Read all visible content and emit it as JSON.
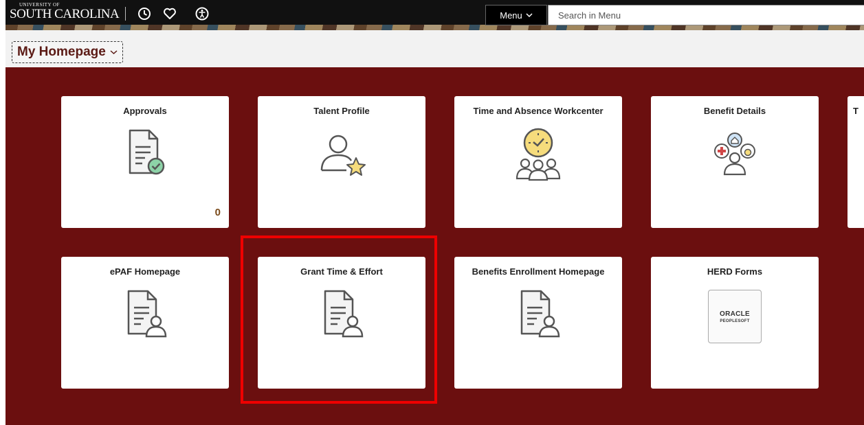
{
  "header": {
    "logo_small": "UNIVERSITY OF",
    "logo_big": "SOUTH CAROLINA",
    "icons": [
      "history-icon",
      "favorites-icon",
      "accessibility-icon"
    ],
    "menu_label": "Menu",
    "search_placeholder": "Search in Menu"
  },
  "subbar": {
    "homepage_label": "My Homepage"
  },
  "tiles": [
    {
      "title": "Approvals",
      "icon": "document-check-icon",
      "count": "0"
    },
    {
      "title": "Talent Profile",
      "icon": "person-star-icon"
    },
    {
      "title": "Time and Absence Workcenter",
      "icon": "clock-group-icon"
    },
    {
      "title": "Benefit Details",
      "icon": "benefits-person-icon"
    },
    {
      "title": "ePAF Homepage",
      "icon": "document-person-icon"
    },
    {
      "title": "Grant Time & Effort",
      "icon": "document-person-icon"
    },
    {
      "title": "Benefits Enrollment Homepage",
      "icon": "document-person-icon"
    },
    {
      "title": "HERD Forms",
      "icon": "oracle-peoplesoft-logo",
      "logo_line1": "ORACLE",
      "logo_line2": "PEOPLESOFT"
    },
    {
      "title": "T",
      "icon": ""
    }
  ],
  "colors": {
    "background": "#6b0f0f",
    "highlight": "#ee0000",
    "topbar": "#111111"
  }
}
